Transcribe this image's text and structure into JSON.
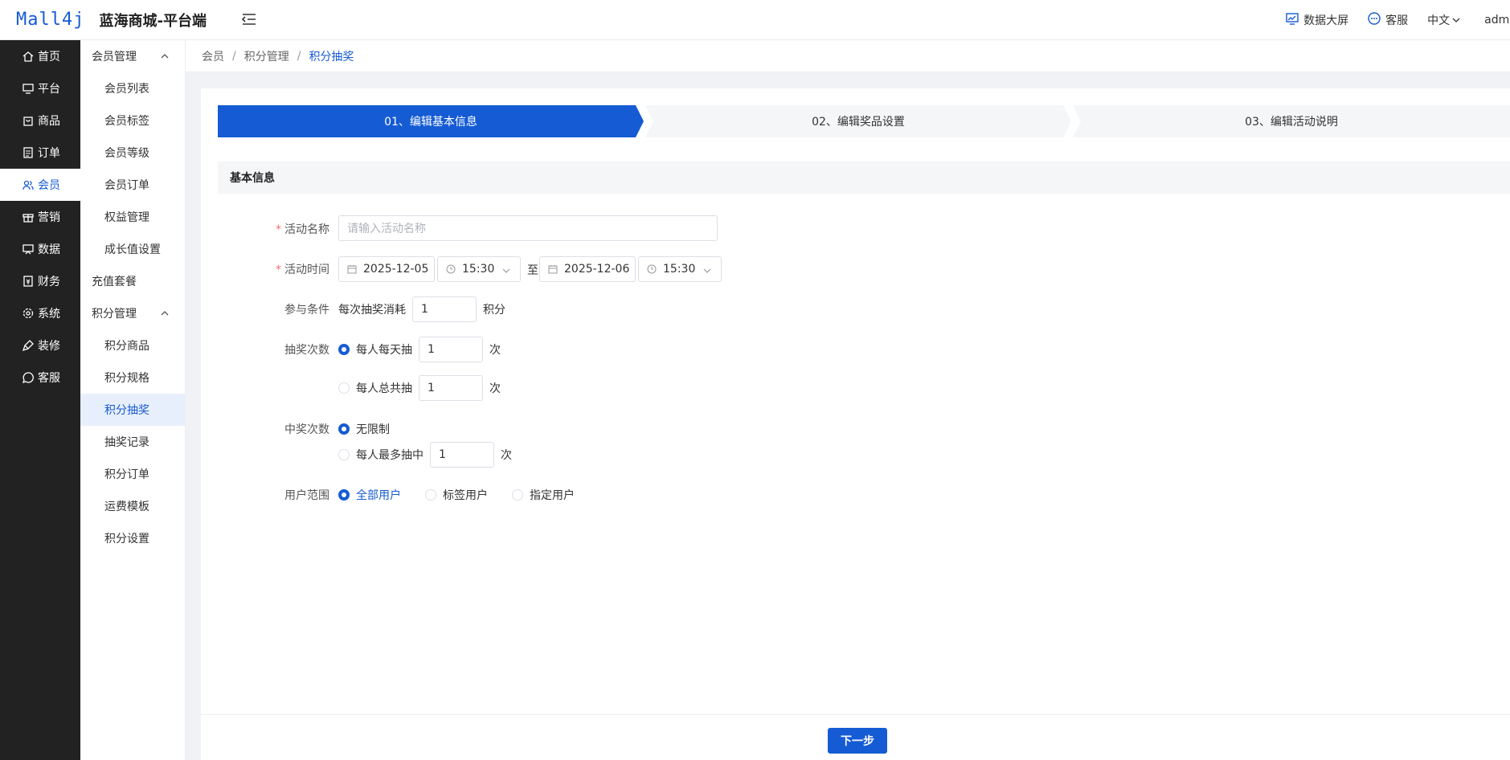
{
  "header": {
    "logo": "Mall4j",
    "title": "蓝海商城-平台端",
    "links": {
      "dashboard": "数据大屏",
      "service": "客服",
      "language": "中文"
    },
    "user": "admin"
  },
  "nav": [
    {
      "label": "首页"
    },
    {
      "label": "平台"
    },
    {
      "label": "商品"
    },
    {
      "label": "订单"
    },
    {
      "label": "会员"
    },
    {
      "label": "营销"
    },
    {
      "label": "数据"
    },
    {
      "label": "财务"
    },
    {
      "label": "系统"
    },
    {
      "label": "装修"
    },
    {
      "label": "客服"
    }
  ],
  "subnav": {
    "group1": "会员管理",
    "items1": [
      "会员列表",
      "会员标签",
      "会员等级",
      "会员订单",
      "权益管理",
      "成长值设置"
    ],
    "recharge": "充值套餐",
    "group2": "积分管理",
    "items2": [
      "积分商品",
      "积分规格",
      "积分抽奖",
      "抽奖记录",
      "积分订单",
      "运费模板",
      "积分设置"
    ]
  },
  "breadcrumb": [
    "会员",
    "积分管理",
    "积分抽奖"
  ],
  "steps": [
    "01、编辑基本信息",
    "02、编辑奖品设置",
    "03、编辑活动说明"
  ],
  "section_title": "基本信息",
  "form": {
    "name_label": "活动名称",
    "name_placeholder": "请输入活动名称",
    "time_label": "活动时间",
    "start_date": "2025-12-05",
    "start_time": "15:30",
    "to": "至",
    "end_date": "2025-12-06",
    "end_time": "15:30",
    "cond_label": "参与条件",
    "cond_prefix": "每次抽奖消耗",
    "cond_value": "1",
    "cond_unit": "积分",
    "draw_label": "抽奖次数",
    "draw_daily": "每人每天抽",
    "draw_daily_value": "1",
    "draw_total": "每人总共抽",
    "draw_total_value": "1",
    "times_unit": "次",
    "win_label": "中奖次数",
    "win_unlimited": "无限制",
    "win_max": "每人最多抽中",
    "win_max_value": "1",
    "scope_label": "用户范围",
    "scope_all": "全部用户",
    "scope_tag": "标签用户",
    "scope_specific": "指定用户"
  },
  "footer": {
    "next": "下一步"
  },
  "colors": {
    "primary": "#155bd4",
    "nav_bg": "#222222"
  }
}
